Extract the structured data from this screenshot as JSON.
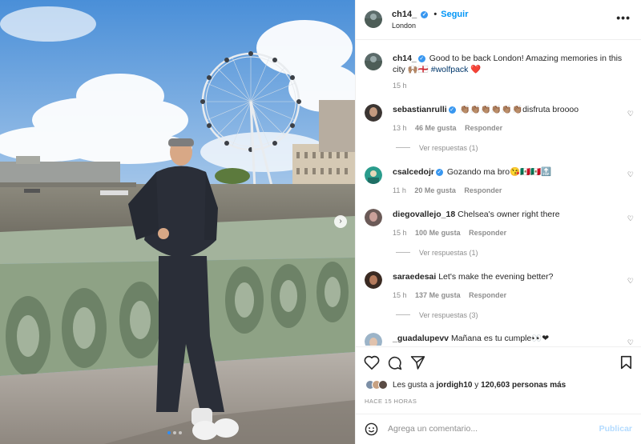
{
  "post": {
    "username": "ch14_",
    "follow_label": "Seguir",
    "location": "London",
    "more_label": "•••",
    "caption": "Good to be back London! Amazing memories in this city 🙌🏽🏴󠁧󠁢󠁥󠁮󠁧󠁿 ",
    "hashtag": "#wolfpack",
    "caption_heart": "❤️",
    "caption_time": "15 h"
  },
  "comments": [
    {
      "username": "sebastianrulli",
      "verified": true,
      "text": "👏🏽👏🏽👏🏽👏🏽👏🏽👏🏽disfruta broooo",
      "time": "13 h",
      "likes": "46 Me gusta",
      "reply_label": "Responder",
      "view_replies": "Ver respuestas (1)"
    },
    {
      "username": "csalcedojr",
      "verified": true,
      "text": "Gozando ma bro😘🇲🇽🇲🇽🔝",
      "time": "11 h",
      "likes": "20 Me gusta",
      "reply_label": "Responder"
    },
    {
      "username": "diegovallejo_18",
      "verified": false,
      "text": "Chelsea's owner right there",
      "time": "15 h",
      "likes": "100 Me gusta",
      "reply_label": "Responder",
      "view_replies": "Ver respuestas (1)"
    },
    {
      "username": "saraedesai",
      "verified": false,
      "text": "Let's make the evening better?",
      "time": "15 h",
      "likes": "137 Me gusta",
      "reply_label": "Responder",
      "view_replies": "Ver respuestas (3)"
    },
    {
      "username": "_guadalupevv",
      "verified": false,
      "text": "Mañana es tu cumple👀❤"
    }
  ],
  "actions": {
    "likes_prefix": "Les gusta a ",
    "likes_user": "jordigh10",
    "likes_middle": " y ",
    "likes_count": "120,603 personas más",
    "post_time": "HACE 15 HORAS"
  },
  "comment_box": {
    "placeholder": "Agrega un comentario...",
    "publish_label": "Publicar"
  },
  "carousel": {
    "next_glyph": "›",
    "slides": 3,
    "active": 1
  },
  "colors": {
    "accent": "#0095f6",
    "verified": "#3897f0",
    "heart": "#ed4956",
    "hashtag": "#00376b"
  }
}
